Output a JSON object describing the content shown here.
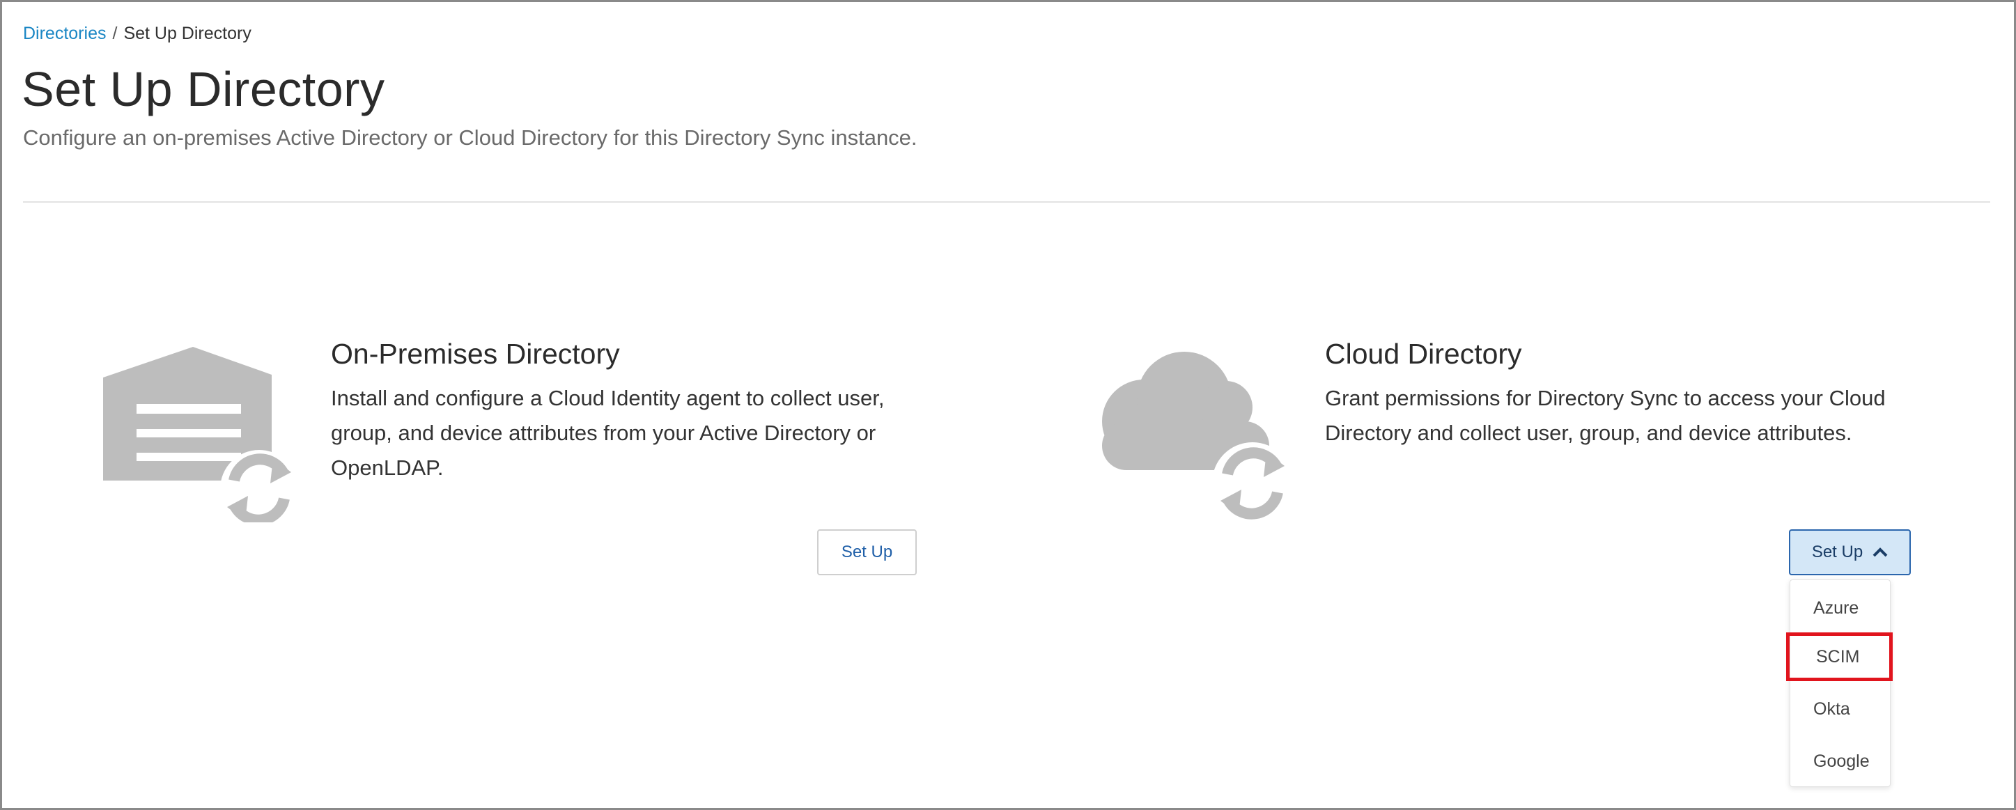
{
  "breadcrumb": {
    "parent": "Directories",
    "separator": "/",
    "current": "Set Up Directory"
  },
  "page": {
    "title": "Set Up Directory",
    "subtitle": "Configure an on-premises Active Directory or Cloud Directory for this Directory Sync instance."
  },
  "cards": {
    "on_premises": {
      "title": "On-Premises Directory",
      "description": "Install and configure a Cloud Identity agent to collect user, group, and device attributes from your Active Directory or OpenLDAP.",
      "button_label": "Set Up",
      "icon": "warehouse-sync-icon"
    },
    "cloud": {
      "title": "Cloud Directory",
      "description": "Grant permissions for Directory Sync to access your Cloud Directory and collect user, group, and device attributes.",
      "button_label": "Set Up",
      "icon": "cloud-sync-icon",
      "dropdown_open": true,
      "options": [
        "Azure",
        "SCIM",
        "Okta",
        "Google"
      ],
      "highlighted_option": "SCIM"
    }
  },
  "colors": {
    "link": "#1a86c4",
    "icon_gray": "#bdbdbd",
    "active_button_bg": "#d4e7f7",
    "active_button_border": "#2b66ad",
    "highlight_border": "#e1141d"
  }
}
